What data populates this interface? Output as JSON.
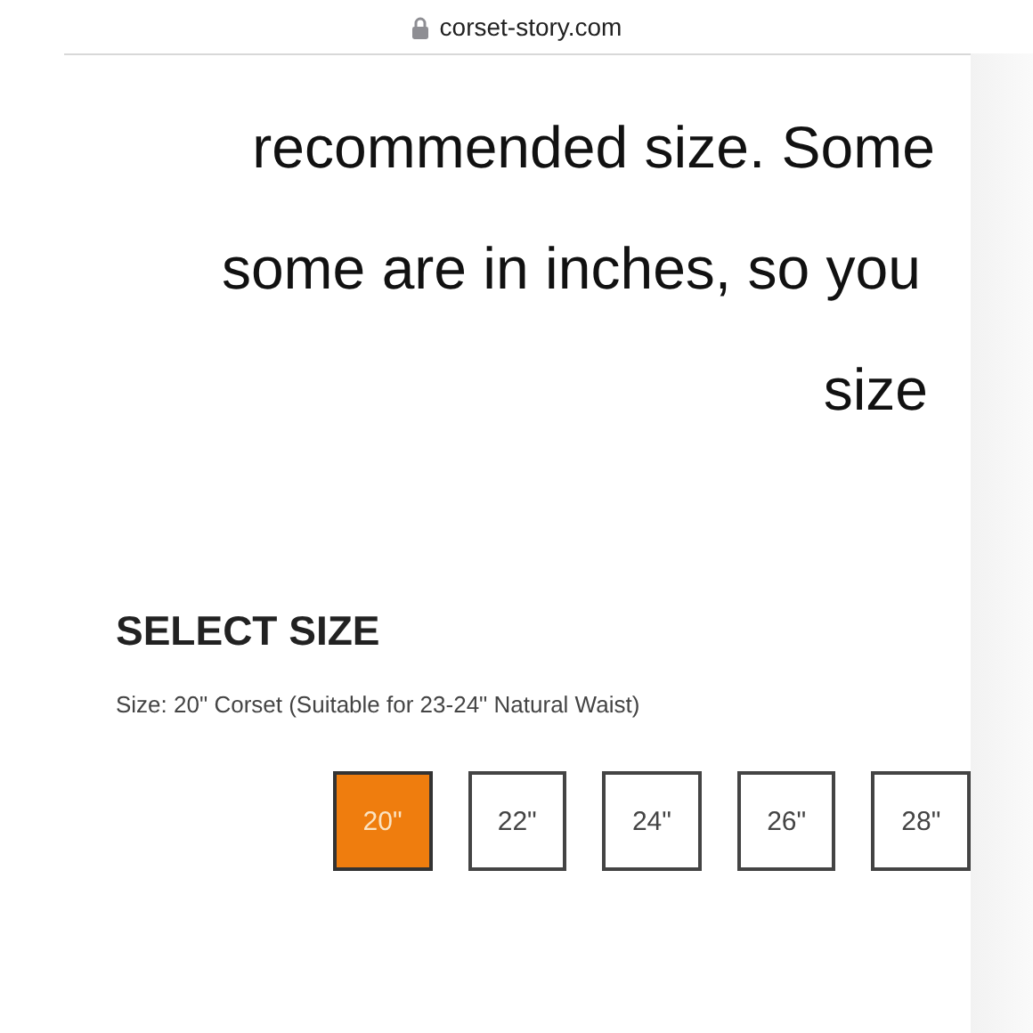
{
  "address_bar": {
    "url": "corset-story.com",
    "secure": true
  },
  "article": {
    "lines": [
      "recommended size. Some",
      "some are in inches, so you",
      "size"
    ]
  },
  "size_selector": {
    "heading": "SELECT SIZE",
    "selection_text": "Size: 20\" Corset (Suitable for 23-24\" Natural Waist)",
    "sizes": [
      {
        "label": "20\"",
        "selected": true
      },
      {
        "label": "22\"",
        "selected": false
      },
      {
        "label": "24\"",
        "selected": false
      },
      {
        "label": "26\"",
        "selected": false
      },
      {
        "label": "28\"",
        "selected": false
      }
    ]
  }
}
